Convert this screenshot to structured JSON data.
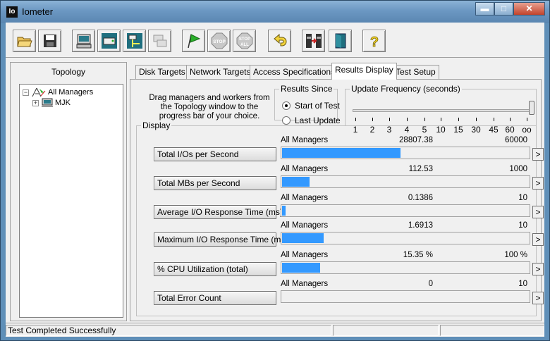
{
  "window": {
    "icon_text": "Io",
    "title": "Iometer",
    "minimize": "▬",
    "maximize": "□",
    "close": "✕"
  },
  "toolbar": {
    "buttons": [
      {
        "name": "open-icon"
      },
      {
        "name": "save-icon"
      },
      {
        "name": "new-manager-icon"
      },
      {
        "name": "new-disk-worker-icon"
      },
      {
        "name": "new-network-worker-icon"
      },
      {
        "name": "copy-worker-icon"
      },
      {
        "name": "start-tests-icon"
      },
      {
        "name": "stop-icon",
        "label": "STOP"
      },
      {
        "name": "stop-all-icon",
        "label_top": "STOP",
        "label_bottom": "ALL"
      },
      {
        "name": "reset-workers-icon"
      },
      {
        "name": "exit-managers-icon"
      },
      {
        "name": "exit-icon"
      },
      {
        "name": "help-icon",
        "label": "?"
      }
    ]
  },
  "topology": {
    "title": "Topology",
    "root": "All Managers",
    "child": "MJK"
  },
  "tabs": [
    "Disk Targets",
    "Network Targets",
    "Access Specifications",
    "Results Display",
    "Test Setup"
  ],
  "active_tab": "Results Display",
  "instructions": "Drag managers and workers from the Topology window to the progress bar of your choice.",
  "results_since": {
    "title": "Results Since",
    "options": [
      "Start of Test",
      "Last Update"
    ],
    "selected": "Start of Test"
  },
  "update_frequency": {
    "title": "Update Frequency (seconds)",
    "ticks": [
      "1",
      "2",
      "3",
      "4",
      "5",
      "10",
      "15",
      "30",
      "45",
      "60",
      "oo"
    ],
    "selected": "oo"
  },
  "display": {
    "title": "Display",
    "arrow": ">",
    "metrics": [
      {
        "button": "Total I/Os per Second",
        "source": "All Managers",
        "value": "28807.38",
        "max": "60000",
        "fill": 0.4801
      },
      {
        "button": "Total MBs per Second",
        "source": "All Managers",
        "value": "112.53",
        "max": "1000",
        "fill": 0.1125
      },
      {
        "button": "Average I/O Response Time (ms)",
        "source": "All Managers",
        "value": "0.1386",
        "max": "10",
        "fill": 0.0139
      },
      {
        "button": "Maximum I/O Response Time (ms)",
        "source": "All Managers",
        "value": "1.6913",
        "max": "10",
        "fill": 0.1691
      },
      {
        "button": "% CPU Utilization (total)",
        "source": "All Managers",
        "value": "15.35 %",
        "max": "100 %",
        "fill": 0.1535
      },
      {
        "button": "Total Error Count",
        "source": "All Managers",
        "value": "0",
        "max": "10",
        "fill": 0
      }
    ]
  },
  "status": {
    "message": "Test Completed Successfully"
  },
  "colors": {
    "bar_fill": "#3399ff",
    "titlebar": "#6b97c2"
  }
}
